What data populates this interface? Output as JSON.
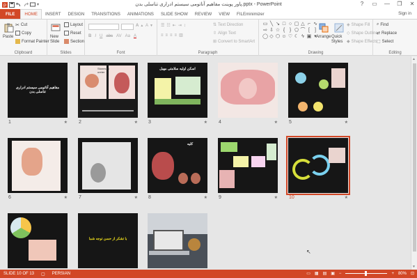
{
  "window": {
    "title": "پاور پوینت مفاهیم آناتومی سیستم ادراری تناسلی بدن.pptx - PowerPoint",
    "sign_in": "Sign in",
    "help": "?",
    "minimize": "—",
    "restore": "❐",
    "close": "✕"
  },
  "tabs": [
    "FILE",
    "HOME",
    "INSERT",
    "DESIGN",
    "TRANSITIONS",
    "ANIMATIONS",
    "SLIDE SHOW",
    "REVIEW",
    "VIEW",
    "FILEminimizer"
  ],
  "ribbon": {
    "clipboard": {
      "label": "Clipboard",
      "paste": "Paste",
      "cut": "Cut",
      "copy": "Copy",
      "format_painter": "Format Painter"
    },
    "slides": {
      "label": "Slides",
      "new_slide": "New Slide",
      "layout": "Layout",
      "reset": "Reset",
      "section": "Section"
    },
    "font": {
      "label": "Font"
    },
    "paragraph": {
      "label": "Paragraph",
      "text_direction": "Text Direction",
      "align_text": "Align Text",
      "convert_smartart": "Convert to SmartArt"
    },
    "drawing": {
      "label": "Drawing",
      "arrange": "Arrange",
      "quick_styles": "Quick Styles",
      "shape_fill": "Shape Fill",
      "shape_outline": "Shape Outline",
      "shape_effects": "Shape Effects"
    },
    "editing": {
      "label": "Editing",
      "find": "Find",
      "replace": "Replace",
      "select": "Select"
    }
  },
  "slides": [
    {
      "num": "1",
      "title": "مفاهیم آناتومی سیستم ادراری تناسلی بدن"
    },
    {
      "num": "2",
      "label": "Stones in ureter"
    },
    {
      "num": "3",
      "title": "اسکن اولیه سلامتی مهبل"
    },
    {
      "num": "4"
    },
    {
      "num": "5"
    },
    {
      "num": "6"
    },
    {
      "num": "7"
    },
    {
      "num": "8",
      "title": "کلیه"
    },
    {
      "num": "9"
    },
    {
      "num": "10"
    },
    {
      "num": "11"
    },
    {
      "num": "12",
      "title": "با تشکر از حسن توجه شما"
    },
    {
      "num": "13"
    }
  ],
  "status": {
    "slide_info": "SLIDE 10 OF 13",
    "language": "PERSIAN",
    "zoom": "80%"
  },
  "colors": {
    "accent": "#d24726",
    "selected_outline": "#d24726"
  }
}
